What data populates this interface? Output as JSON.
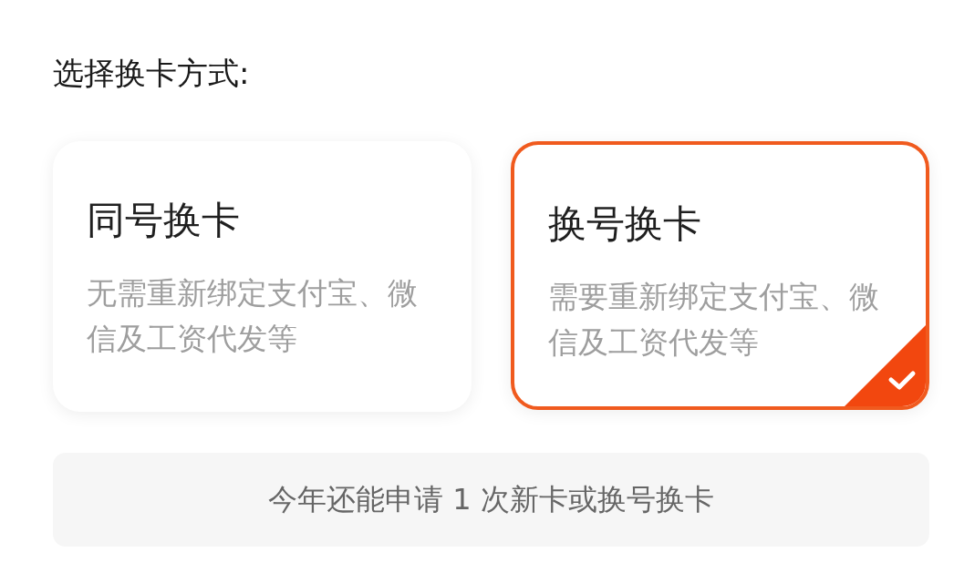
{
  "heading": "选择换卡方式:",
  "options": [
    {
      "title": "同号换卡",
      "description": "无需重新绑定支付宝、微信及工资代发等",
      "selected": false
    },
    {
      "title": "换号换卡",
      "description": "需要重新绑定支付宝、微信及工资代发等",
      "selected": true
    }
  ],
  "notice": "今年还能申请 1 次新卡或换号换卡"
}
